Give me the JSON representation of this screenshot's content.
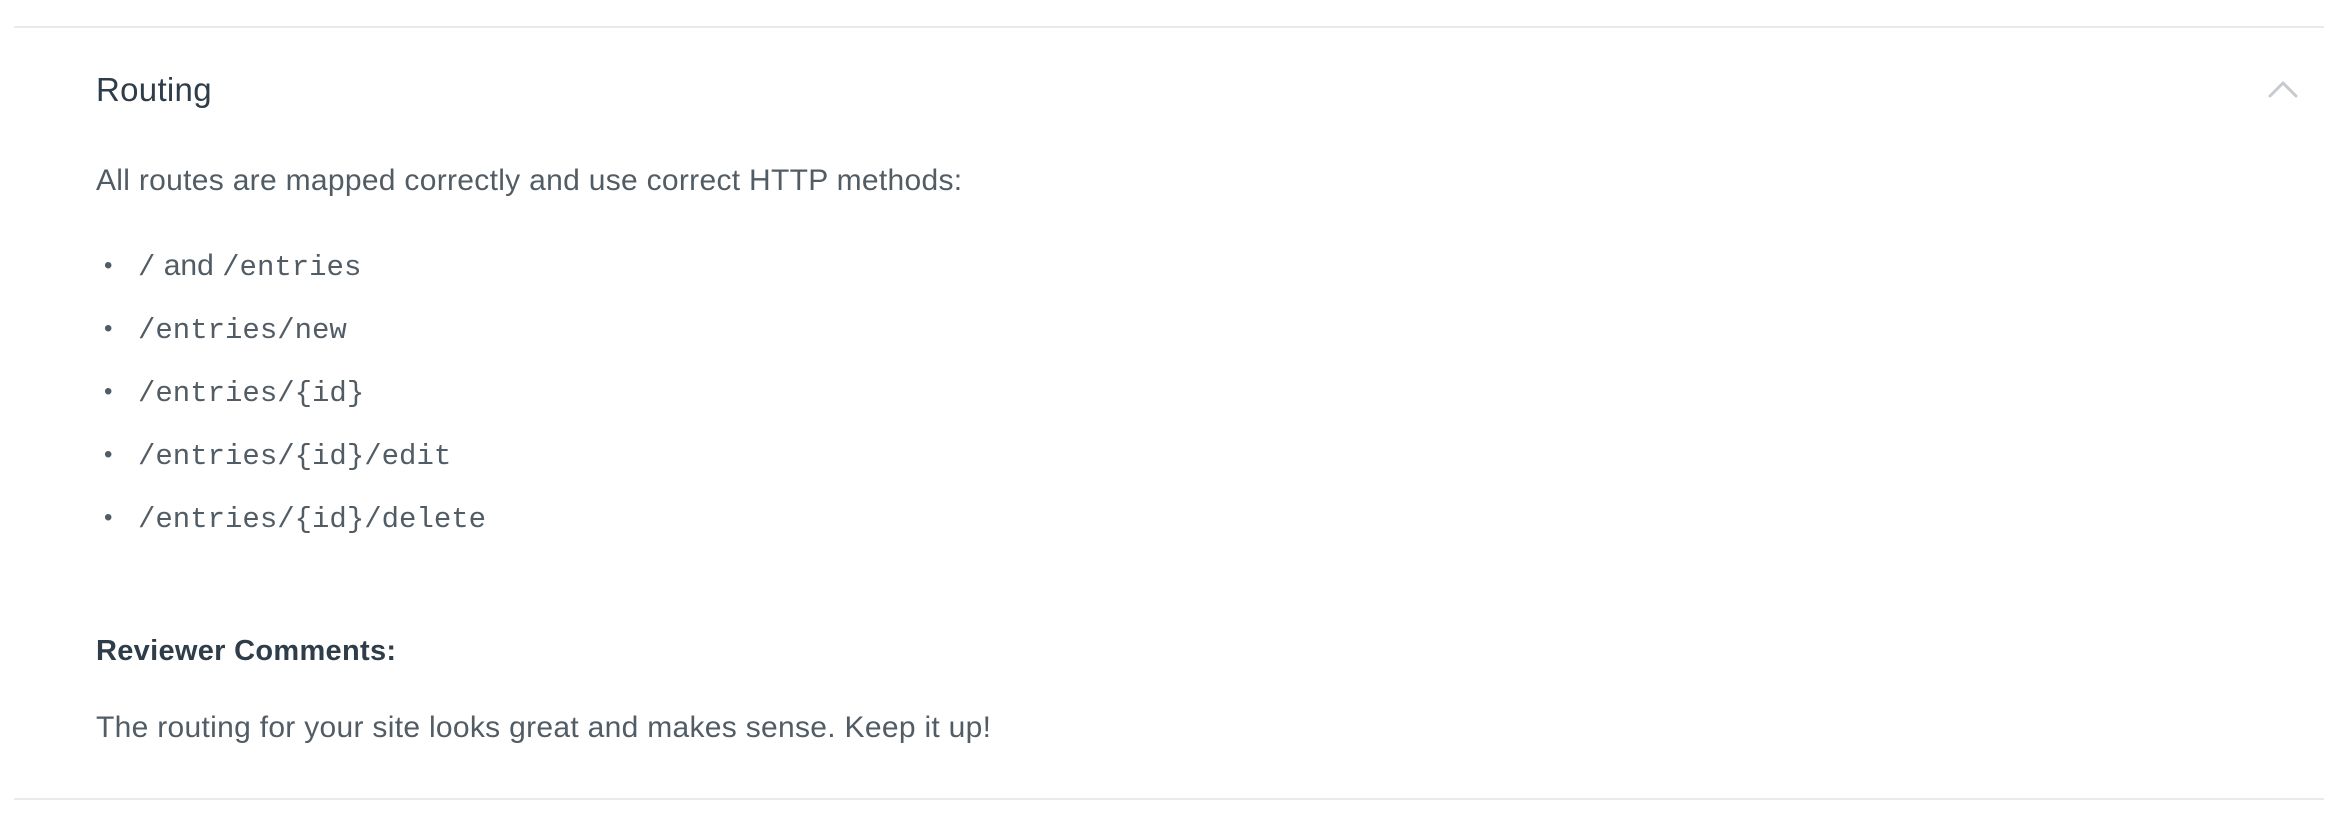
{
  "section": {
    "title": "Routing",
    "toggle_icon": "chevron-up-icon",
    "toggle_color": "#c7cbd0"
  },
  "intro": "All routes are mapped correctly and use correct HTTP methods:",
  "routes": [
    {
      "bullet": "•",
      "prefix_mono": "/",
      "middle": " and ",
      "suffix_mono": "/entries"
    },
    {
      "bullet": "•",
      "prefix_mono": "/entries/new",
      "middle": "",
      "suffix_mono": ""
    },
    {
      "bullet": "•",
      "prefix_mono": "/entries/{id}",
      "middle": "",
      "suffix_mono": ""
    },
    {
      "bullet": "•",
      "prefix_mono": "/entries/{id}/edit",
      "middle": "",
      "suffix_mono": ""
    },
    {
      "bullet": "•",
      "prefix_mono": "/entries/{id}/delete",
      "middle": "",
      "suffix_mono": ""
    }
  ],
  "reviewer": {
    "label": "Reviewer Comments:",
    "comment": "The routing for your site looks great and makes sense. Keep it up!"
  },
  "colors": {
    "heading": "#2e3d49",
    "body_text": "#525c65",
    "divider": "#e8eaed"
  }
}
